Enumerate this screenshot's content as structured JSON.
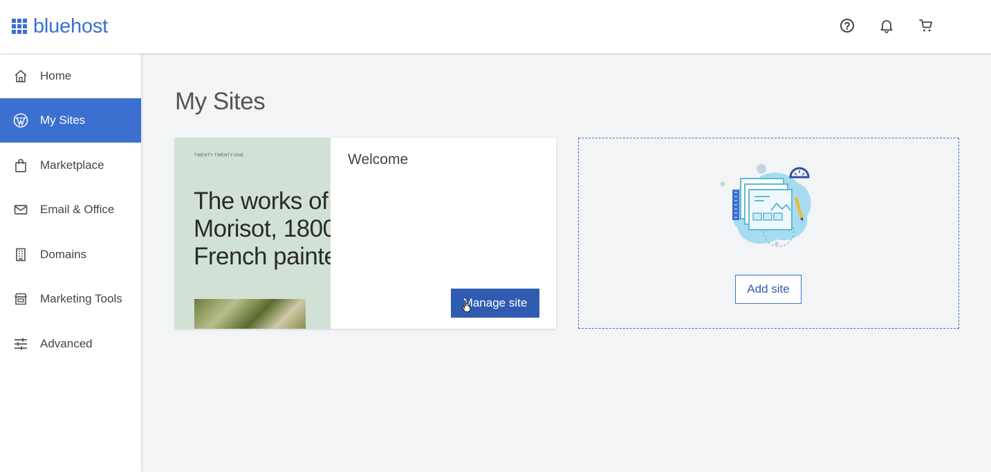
{
  "brand": {
    "name": "bluehost",
    "color": "#3b6fd0"
  },
  "topbar": {
    "icons": [
      "help-circle-icon",
      "bell-icon",
      "cart-icon"
    ]
  },
  "sidebar": {
    "items": [
      {
        "label": "Home",
        "icon": "home-icon",
        "active": false
      },
      {
        "label": "My Sites",
        "icon": "wordpress-icon",
        "active": true
      },
      {
        "label": "Marketplace",
        "icon": "shopping-bag-icon",
        "active": false
      },
      {
        "label": "Email & Office",
        "icon": "mail-icon",
        "active": false
      },
      {
        "label": "Domains",
        "icon": "building-icon",
        "active": false
      },
      {
        "label": "Marketing Tools",
        "icon": "storefront-icon",
        "active": false
      },
      {
        "label": "Advanced",
        "icon": "sliders-icon",
        "active": false
      }
    ]
  },
  "main": {
    "title": "My Sites",
    "site_card": {
      "thumbnail": {
        "theme_label": "TWENTY TWENTY-ONE",
        "headline": "The works of Morisot, 1800 French painte"
      },
      "name": "Welcome",
      "manage_label": "Manage site"
    },
    "add_card": {
      "button_label": "Add site"
    }
  },
  "colors": {
    "accent": "#3b6fd0",
    "button_dark": "#2f5bb0",
    "background": "#f2f4f5"
  }
}
